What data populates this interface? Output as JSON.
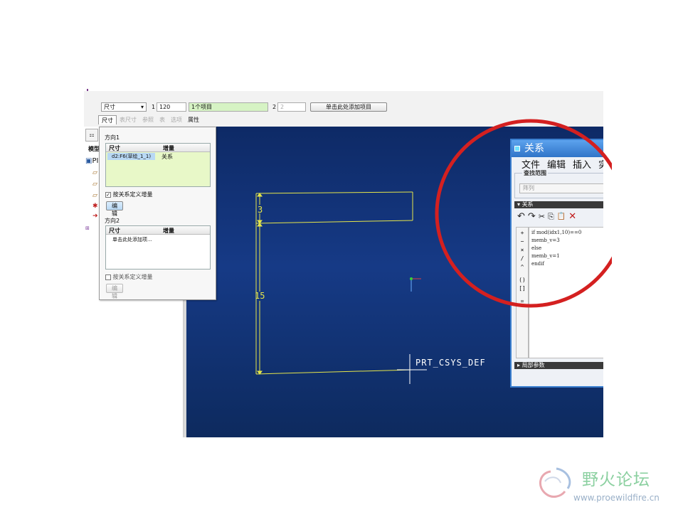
{
  "dashboard": {
    "type_dropdown": "尺寸",
    "dir1_label": "1",
    "dir1_count": "120",
    "dir1_items": "1个项目",
    "dir2_label": "2",
    "dir2_count": "2",
    "dir2_add": "单击此处添加项目",
    "tabs": [
      {
        "label": "尺寸",
        "active": true
      },
      {
        "label": "表尺寸",
        "active": false
      },
      {
        "label": "参照",
        "active": false
      },
      {
        "label": "表",
        "active": false
      },
      {
        "label": "选项",
        "active": false
      },
      {
        "label": "属性",
        "active": false
      }
    ]
  },
  "tree": {
    "header": "模型",
    "root": "PI"
  },
  "panel": {
    "dir1_title": "方向1",
    "col_dim": "尺寸",
    "col_inc": "增量",
    "row1_dim": "d2:F6(草绘_1_1)",
    "row1_inc": "关系",
    "relation_check1": "按关系定义增量",
    "edit1": "编辑",
    "dir2_title": "方向2",
    "dir2_placeholder": "单击此处添加项...",
    "relation_check2": "按关系定义增量",
    "edit2": "编辑"
  },
  "sketch": {
    "dim_top": "3",
    "dim_side": "15",
    "csys_label": "PRT_CSYS_DEF"
  },
  "relations": {
    "title": "关系",
    "menu": [
      "文件",
      "编辑",
      "插入",
      "实"
    ],
    "find_label": "查找范围",
    "find_value": "阵列",
    "section_label": "关系",
    "toolbar": [
      "↶",
      "↷",
      "✂",
      "⎘",
      "📋",
      "✕"
    ],
    "ops": [
      "+",
      "−",
      "×",
      "/",
      "^",
      "()",
      "[]",
      "="
    ],
    "code_lines": [
      "if  mod(idx1,10)==0",
      "memb_v=3",
      "else",
      "memb_v=1",
      "endif"
    ],
    "local_params": "局部参数"
  },
  "watermark": {
    "cn": "野火论坛",
    "url": "www.proewildfire.cn"
  },
  "colors": {
    "sketch_line": "#e6e64a",
    "annotation_circle": "#d42020"
  }
}
